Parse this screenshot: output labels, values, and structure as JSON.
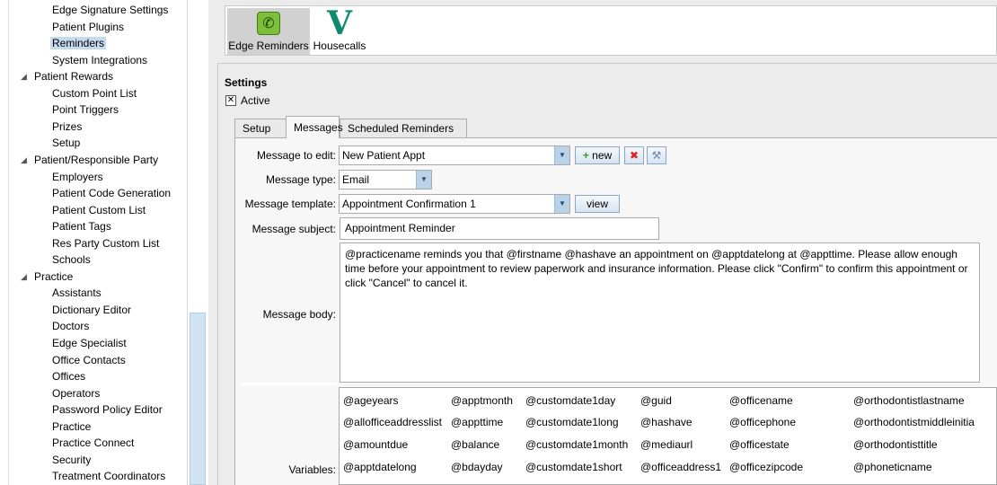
{
  "tree": {
    "items": [
      {
        "label": "Edge Signature Settings",
        "level": 2
      },
      {
        "label": "Patient Plugins",
        "level": 2
      },
      {
        "label": "Reminders",
        "level": 2,
        "selected": true
      },
      {
        "label": "System Integrations",
        "level": 2
      },
      {
        "label": "Patient Rewards",
        "level": 1,
        "expanded": true
      },
      {
        "label": "Custom Point List",
        "level": 2
      },
      {
        "label": "Point Triggers",
        "level": 2
      },
      {
        "label": "Prizes",
        "level": 2
      },
      {
        "label": "Setup",
        "level": 2
      },
      {
        "label": "Patient/Responsible Party",
        "level": 1,
        "expanded": true
      },
      {
        "label": "Employers",
        "level": 2
      },
      {
        "label": "Patient Code Generation",
        "level": 2
      },
      {
        "label": "Patient Custom List",
        "level": 2
      },
      {
        "label": "Patient Tags",
        "level": 2
      },
      {
        "label": "Res Party Custom List",
        "level": 2
      },
      {
        "label": "Schools",
        "level": 2
      },
      {
        "label": "Practice",
        "level": 1,
        "expanded": true
      },
      {
        "label": "Assistants",
        "level": 2
      },
      {
        "label": "Dictionary Editor",
        "level": 2
      },
      {
        "label": "Doctors",
        "level": 2
      },
      {
        "label": "Edge Specialist",
        "level": 2
      },
      {
        "label": "Office Contacts",
        "level": 2
      },
      {
        "label": "Offices",
        "level": 2
      },
      {
        "label": "Operators",
        "level": 2
      },
      {
        "label": "Password Policy Editor",
        "level": 2
      },
      {
        "label": "Practice",
        "level": 2
      },
      {
        "label": "Practice Connect",
        "level": 2
      },
      {
        "label": "Security",
        "level": 2
      },
      {
        "label": "Treatment Coordinators",
        "level": 2
      }
    ]
  },
  "plugins": {
    "edge_reminders": "Edge Reminders",
    "housecalls": "Housecalls",
    "housecalls_logo": "V"
  },
  "settings": {
    "title": "Settings",
    "active_label": "Active",
    "active_checked": true,
    "check_mark": "✕"
  },
  "tabs": {
    "setup": "Setup",
    "messages": "Messages",
    "scheduled": "Scheduled Reminders"
  },
  "form": {
    "message_to_edit_label": "Message to edit:",
    "message_to_edit_value": "New Patient Appt",
    "new_button": "new",
    "message_type_label": "Message type:",
    "message_type_value": "Email",
    "message_template_label": "Message template:",
    "message_template_value": "Appointment Confirmation 1",
    "view_button": "view",
    "message_subject_label": "Message subject:",
    "message_subject_value": "Appointment Reminder",
    "message_body_label": "Message body:",
    "message_body_value": "@practicename reminds you that @firstname @hashave an appointment on @apptdatelong at @appttime. Please allow enough time before your appointment to review paperwork and insurance information.  Please click \"Confirm\" to confirm this appointment or click \"Cancel\" to cancel it.",
    "variables_label": "Variables:"
  },
  "variables": {
    "col1": [
      "@ageyears",
      "@allofficeaddresslist",
      "@amountdue",
      "@apptdatelong"
    ],
    "col2": [
      "@apptmonth",
      "@appttime",
      "@balance",
      "@bdayday"
    ],
    "col3": [
      "@customdate1day",
      "@customdate1long",
      "@customdate1month",
      "@customdate1short"
    ],
    "col4": [
      "@guid",
      "@hashave",
      "@mediaurl",
      "@officeaddress1"
    ],
    "col5": [
      "@officename",
      "@officephone",
      "@officestate",
      "@officezipcode"
    ],
    "col6": [
      "@orthodontistlastname",
      "@orthodontistmiddleinitia",
      "@orthodontisttitle",
      "@phoneticname"
    ]
  },
  "colors": {
    "accent_green": "#7dbf3a",
    "housecalls_teal": "#0f8a6e",
    "selection": "#c5daf0",
    "dropdown_blue": "#b9d2e8"
  },
  "icons": {
    "phone": "phone-icon",
    "add": "plus-icon",
    "delete": "red-x-icon",
    "tools": "wrench-icon",
    "expand": "triangle-down-icon"
  }
}
